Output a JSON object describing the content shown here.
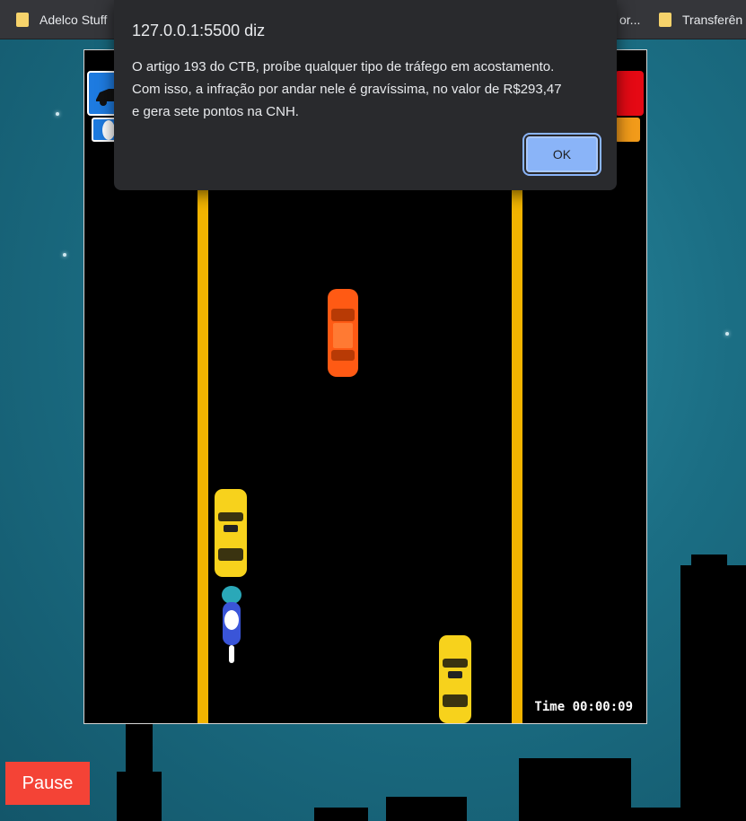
{
  "bookmarks": [
    {
      "label": "Adelco Stuff",
      "icon": "folder-icon"
    },
    {
      "label": "Transferên",
      "icon": "folder-icon"
    },
    {
      "label": "or...",
      "icon": "folder-icon"
    }
  ],
  "dialog": {
    "title": "127.0.0.1:5500 diz",
    "message_lines": [
      "O artigo 193 do CTB, proíbe qualquer tipo de tráfego em acostamento.",
      "Com isso, a infração por andar nele é gravíssima, no valor de R$293,47",
      "e gera sete pontos na CNH."
    ],
    "ok_label": "OK"
  },
  "game": {
    "timer": "Time 00:00:09",
    "colors": {
      "lane": "#f2b400",
      "background": "#000000"
    },
    "vehicles": [
      {
        "type": "orange-car"
      },
      {
        "type": "yellow-taxi"
      },
      {
        "type": "blue-motorcycle"
      },
      {
        "type": "yellow-taxi"
      }
    ]
  },
  "controls": {
    "pause_label": "Pause",
    "pause_color": "#f44336"
  }
}
